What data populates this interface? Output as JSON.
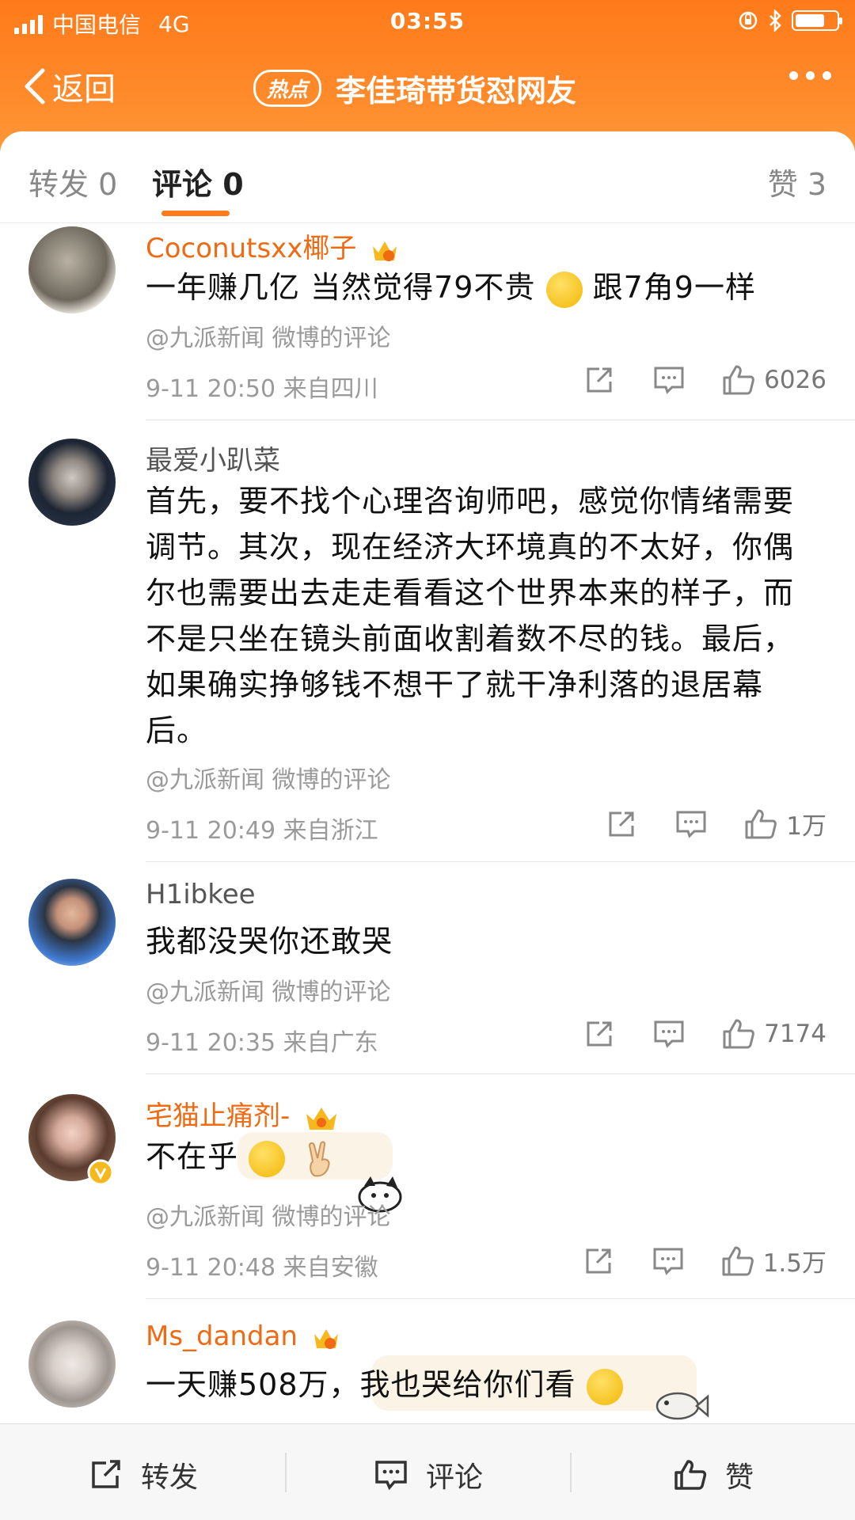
{
  "status": {
    "carrier": "中国电信",
    "network": "4G",
    "time": "03:55"
  },
  "nav": {
    "back_label": "返回",
    "badge": "热点",
    "title": "李佳琦带货怼网友"
  },
  "tabs": {
    "repost": "转发 0",
    "comment": "评论 0",
    "like": "赞 3"
  },
  "comments": [
    {
      "user": "Coconutsxx椰子",
      "text": "一年赚几亿 当然觉得79不贵",
      "text_after": "跟7角9一样",
      "source": "@九派新闻 微博的评论",
      "time_loc": "9-11 20:50  来自四川",
      "likes": "6026"
    },
    {
      "user": "最爱小趴菜",
      "text_lines": [
        "首先，要不找个心理咨询师吧，感觉你情绪需要",
        "调节。其次，现在经济大环境真的不太好，你偶",
        "尔也需要出去走走看看这个世界本来的样子，而",
        "不是只坐在镜头前面收割着数不尽的钱。最后，",
        "如果确实挣够钱不想干了就干净利落的退居幕",
        "后。"
      ],
      "source": "@九派新闻 微博的评论",
      "time_loc": "9-11 20:49  来自浙江",
      "likes": "1万"
    },
    {
      "user": "H1ibkee",
      "text": "我都没哭你还敢哭",
      "source": "@九派新闻 微博的评论",
      "time_loc": "9-11 20:35  来自广东",
      "likes": "7174"
    },
    {
      "user": "宅猫止痛剂-",
      "text": "不在乎",
      "source": "@九派新闻 微博的评论",
      "time_loc": "9-11 20:48  来自安徽",
      "likes": "1.5万"
    },
    {
      "user": "Ms_dandan",
      "text": "一天赚508万，我也哭给你们看"
    }
  ],
  "bottom": {
    "repost": "转发",
    "comment": "评论",
    "like": "赞"
  },
  "colors": {
    "accent": "#ff7a1a",
    "vip_name": "#ef6a12",
    "meta": "#9a9a9a"
  }
}
